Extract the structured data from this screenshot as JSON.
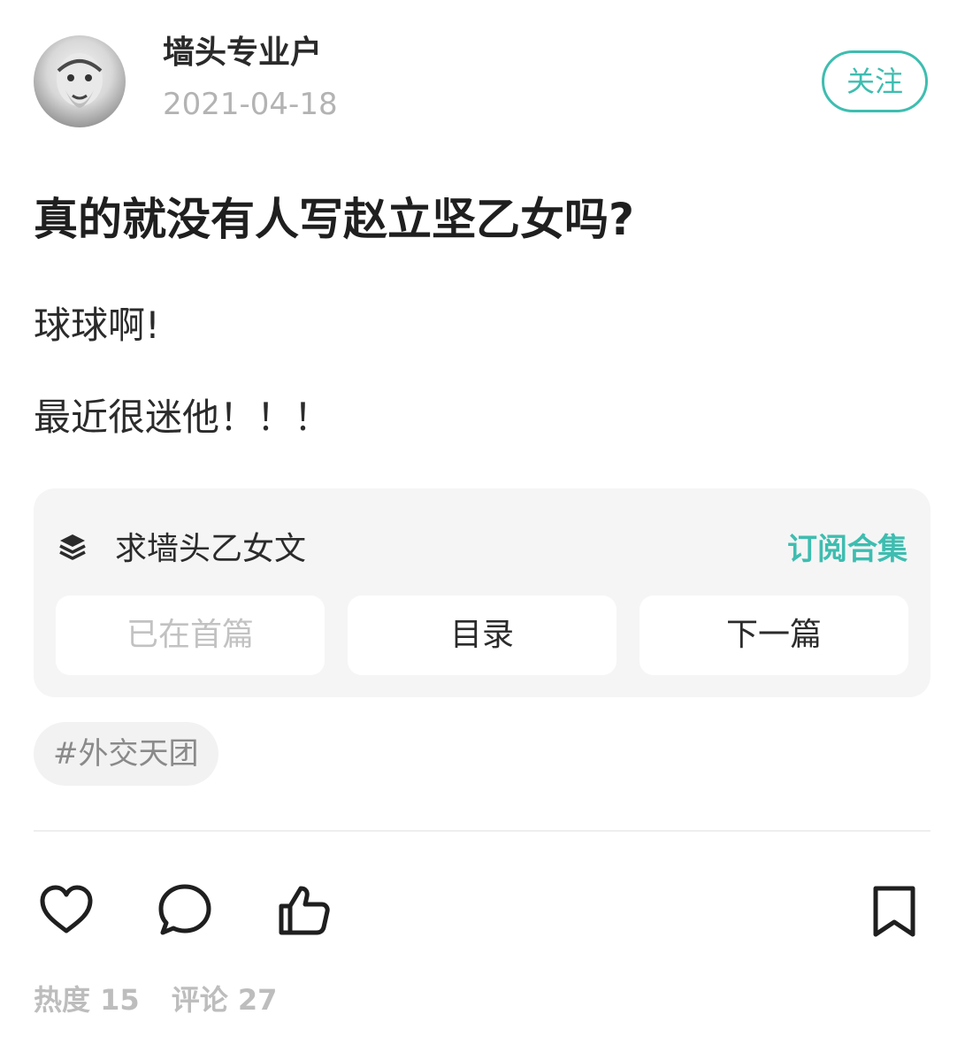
{
  "author": {
    "name": "墙头专业户",
    "date": "2021-04-18",
    "follow_label": "关注"
  },
  "post": {
    "title": "真的就没有人写赵立坚乙女吗?",
    "paragraphs": [
      "球球啊!",
      "最近很迷他！！！"
    ]
  },
  "collection": {
    "icon": "stack-icon",
    "name": "求墙头乙女文",
    "subscribe_label": "订阅合集",
    "nav": {
      "first_label": "已在首篇",
      "toc_label": "目录",
      "next_label": "下一篇"
    }
  },
  "tag": {
    "label": "#外交天团"
  },
  "actions": {
    "icons": [
      "heart-icon",
      "comment-icon",
      "thumbs-up-icon",
      "bookmark-icon"
    ]
  },
  "stats": {
    "heat_label": "热度 15",
    "comments_label": "评论 27"
  },
  "colors": {
    "accent": "#3ebdb0",
    "muted_text": "#b3b3b3",
    "card_bg": "#f5f5f5"
  }
}
